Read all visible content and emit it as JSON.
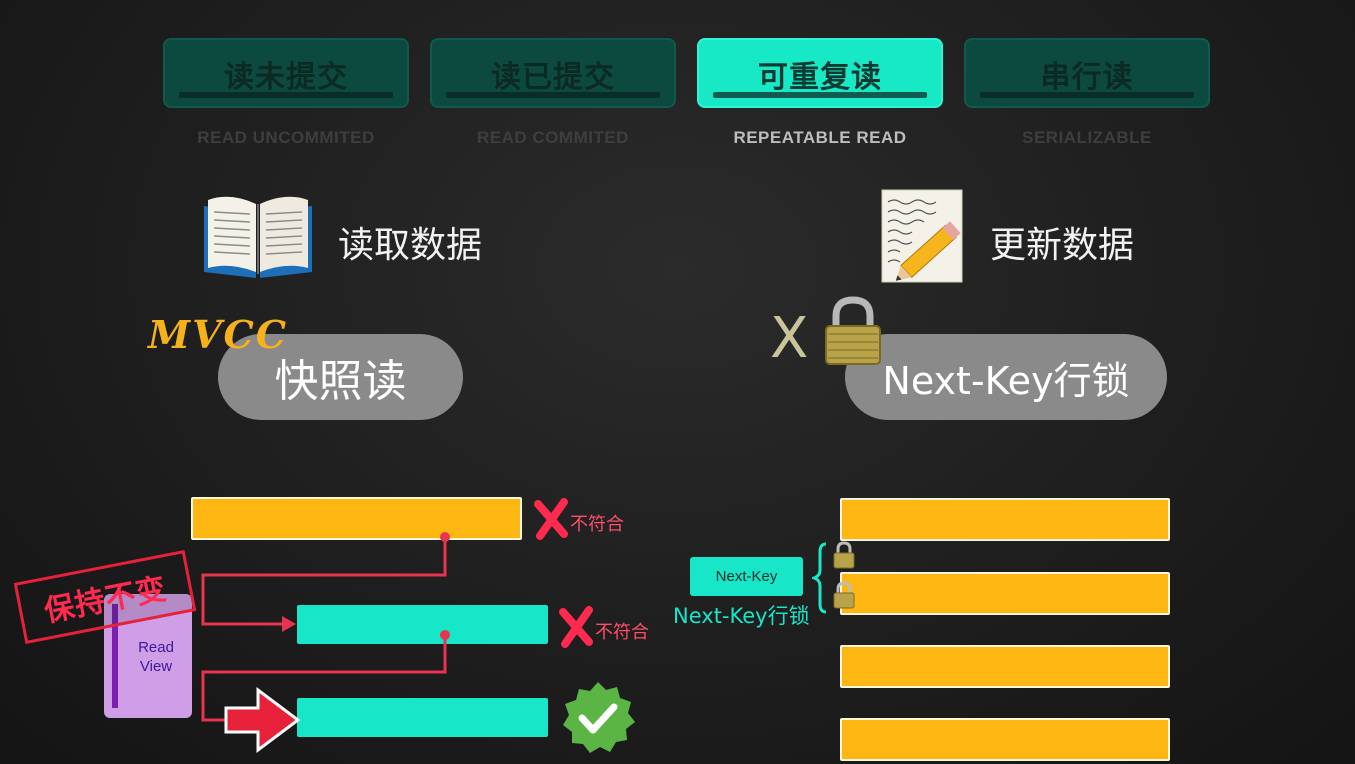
{
  "tabs": [
    {
      "label": "读未提交",
      "sub": "READ UNCOMMITED"
    },
    {
      "label": "读已提交",
      "sub": "READ COMMITED"
    },
    {
      "label": "可重复读",
      "sub": "REPEATABLE READ",
      "active": true
    },
    {
      "label": "串行读",
      "sub": "SERIALIZABLE"
    }
  ],
  "left": {
    "icon": "open-book-icon",
    "title": "读取数据",
    "mvcc": "MVCC",
    "pill": "快照读",
    "reject1": "不符合",
    "reject2": "不符合",
    "stamp": "保持不变",
    "readview": "Read\nView"
  },
  "right": {
    "icon": "pencil-paper-icon",
    "title": "更新数据",
    "x_mark": "X",
    "pill": "Next-Key行锁",
    "nextkey_box": "Next-Key",
    "nextkey_caption": "Next-Key行锁"
  },
  "colors": {
    "accent": "#17e9c6",
    "yellow": "#fdb612",
    "red": "#ff3355"
  }
}
